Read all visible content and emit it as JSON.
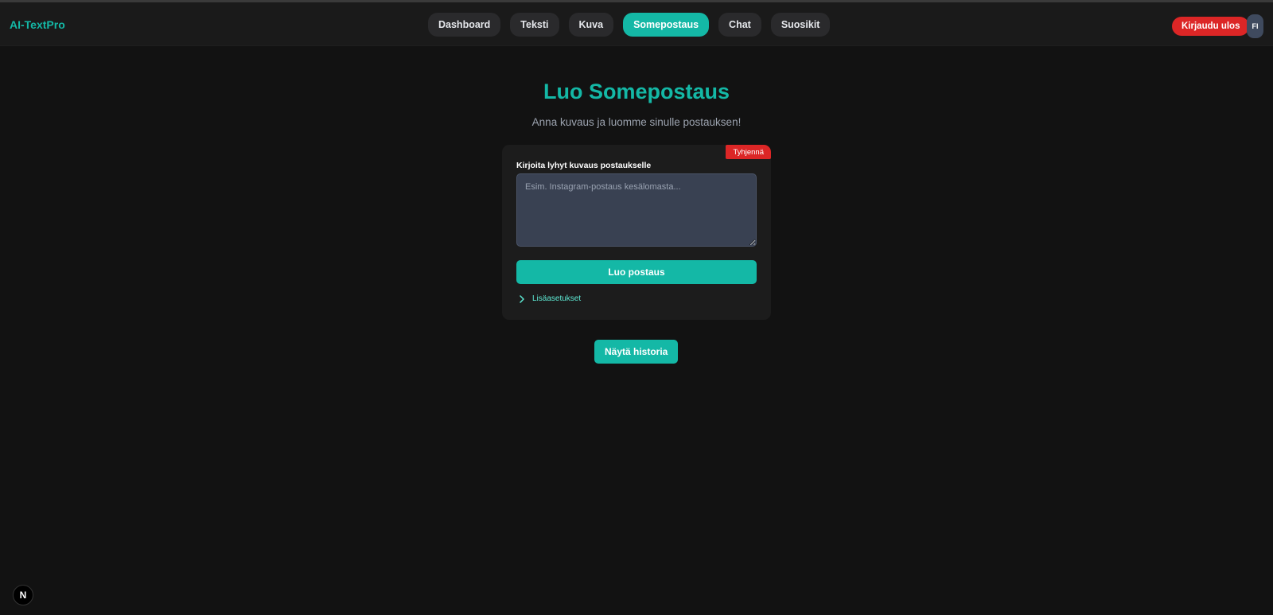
{
  "header": {
    "brand": "AI-TextPro",
    "nav": [
      {
        "label": "Dashboard",
        "active": false
      },
      {
        "label": "Teksti",
        "active": false
      },
      {
        "label": "Kuva",
        "active": false
      },
      {
        "label": "Somepostaus",
        "active": true
      },
      {
        "label": "Chat",
        "active": false
      },
      {
        "label": "Suosikit",
        "active": false
      }
    ],
    "logout_label": "Kirjaudu ulos",
    "language_label": "FI"
  },
  "main": {
    "title": "Luo Somepostaus",
    "subtitle": "Anna kuvaus ja luomme sinulle postauksen!",
    "form": {
      "clear_label": "Tyhjennä",
      "field_label": "Kirjoita lyhyt kuvaus postaukselle",
      "textarea_value": "",
      "textarea_placeholder": "Esim. Instagram-postaus kesälomasta...",
      "submit_label": "Luo postaus",
      "advanced_label": "Lisäasetukset",
      "advanced_icon": "chevron-right-icon"
    },
    "history_label": "Näytä historia"
  },
  "framework_badge": {
    "label": "N",
    "icon": "nextjs-logo-icon"
  },
  "colors": {
    "background": "#121212",
    "header": "#1a1a1a",
    "card": "#1c1c1c",
    "accent": "#14b8a6",
    "danger": "#dc2626",
    "input": "#394152"
  }
}
